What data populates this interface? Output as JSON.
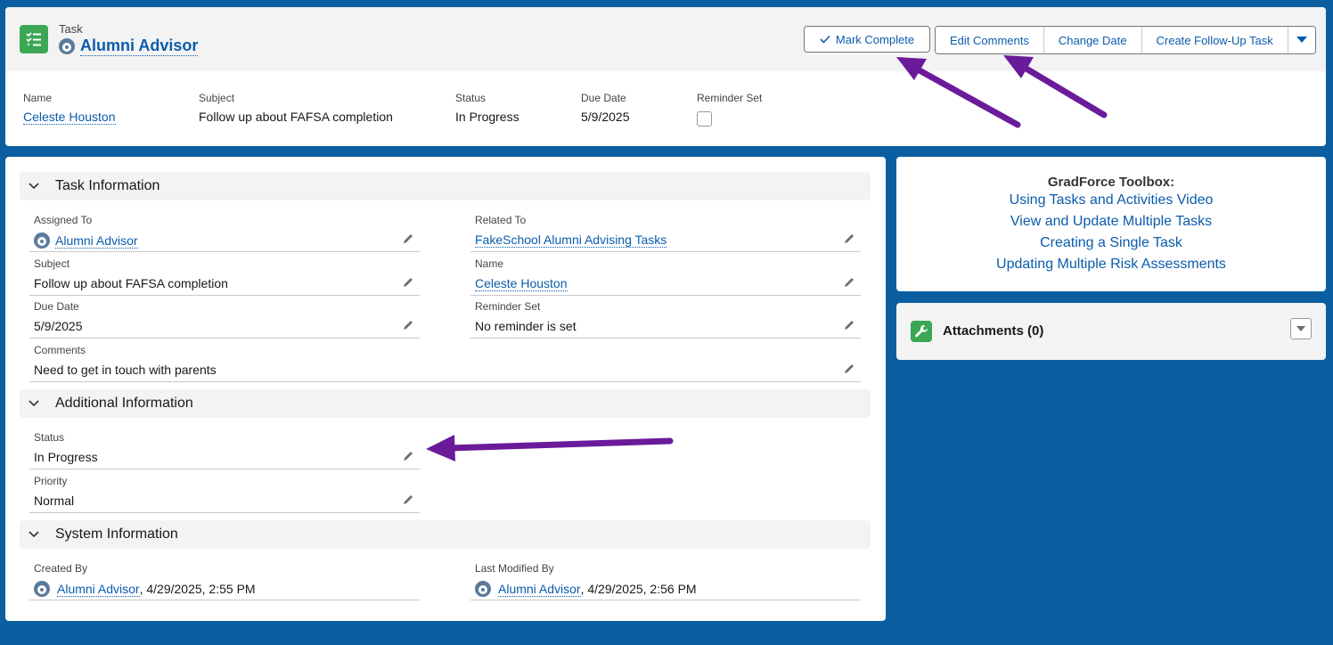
{
  "header": {
    "object_type": "Task",
    "title": "Alumni Advisor",
    "buttons": {
      "mark_complete": "Mark Complete",
      "edit_comments": "Edit Comments",
      "change_date": "Change Date",
      "create_follow_up": "Create Follow-Up Task"
    },
    "highlights": [
      {
        "label": "Name",
        "value": "Celeste Houston"
      },
      {
        "label": "Subject",
        "value": "Follow up about FAFSA completion"
      },
      {
        "label": "Status",
        "value": "In Progress"
      },
      {
        "label": "Due Date",
        "value": "5/9/2025"
      },
      {
        "label": "Reminder Set",
        "checked": false
      }
    ]
  },
  "sections": {
    "task_information": {
      "title": "Task Information",
      "assigned_to": {
        "label": "Assigned To",
        "value": "Alumni Advisor"
      },
      "related_to": {
        "label": "Related To",
        "value": "FakeSchool Alumni Advising Tasks"
      },
      "subject": {
        "label": "Subject",
        "value": "Follow up about FAFSA completion"
      },
      "name": {
        "label": "Name",
        "value": "Celeste Houston"
      },
      "due_date": {
        "label": "Due Date",
        "value": "5/9/2025"
      },
      "reminder_set": {
        "label": "Reminder Set",
        "value": "No reminder is set"
      },
      "comments": {
        "label": "Comments",
        "value": "Need to get in touch with parents"
      }
    },
    "additional_information": {
      "title": "Additional Information",
      "status": {
        "label": "Status",
        "value": "In Progress"
      },
      "priority": {
        "label": "Priority",
        "value": "Normal"
      }
    },
    "system_information": {
      "title": "System Information",
      "created_by": {
        "label": "Created By",
        "user": "Alumni Advisor",
        "timestamp": ", 4/29/2025, 2:55 PM"
      },
      "last_modified_by": {
        "label": "Last Modified By",
        "user": "Alumni Advisor",
        "timestamp": ", 4/29/2025, 2:56 PM"
      }
    }
  },
  "toolbox": {
    "title": "GradForce Toolbox:",
    "links": [
      "Using Tasks and Activities Video",
      "View and Update Multiple Tasks",
      "Creating a Single Task",
      "Updating Multiple Risk Assessments"
    ]
  },
  "attachments": {
    "title": "Attachments (0)"
  },
  "colors": {
    "background": "#0b5fa0",
    "link": "#0b5cab",
    "task_icon": "#3ba755",
    "annotation_arrow": "#6a1b9a"
  }
}
